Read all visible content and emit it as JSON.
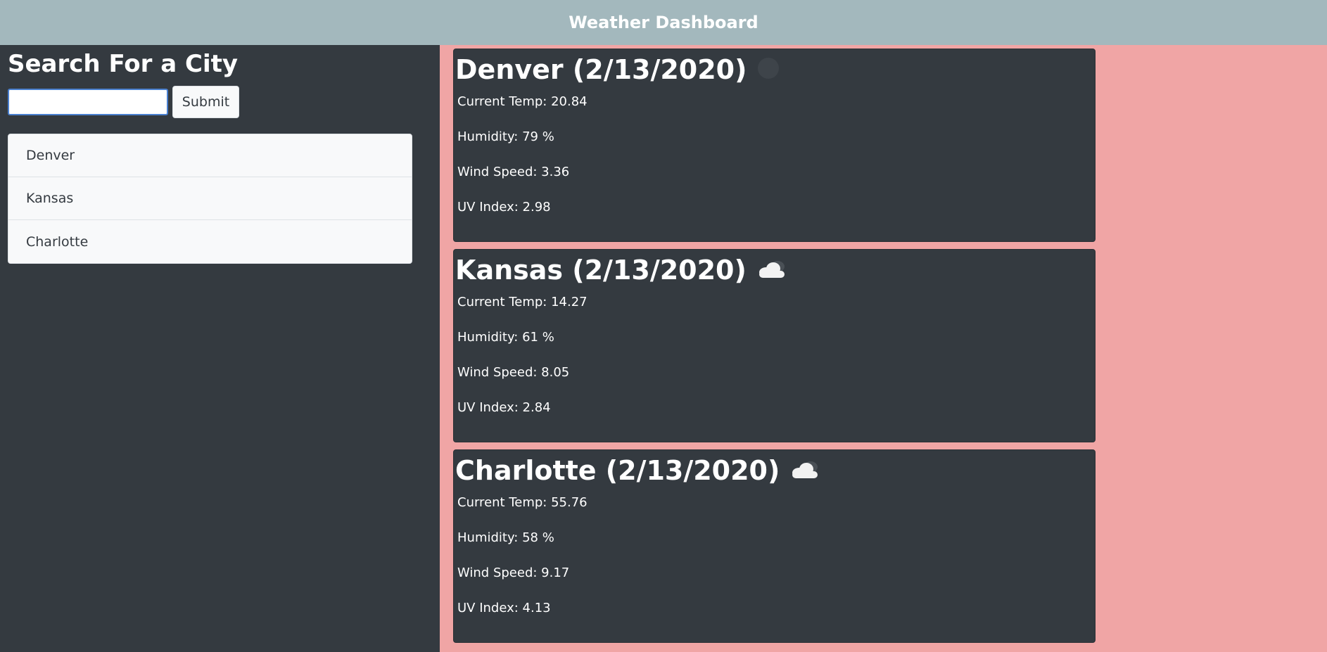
{
  "header": {
    "title": "Weather Dashboard"
  },
  "sidebar": {
    "heading": "Search For a City",
    "search": {
      "value": "",
      "placeholder": ""
    },
    "submit_label": "Submit",
    "cities": [
      "Denver",
      "Kansas",
      "Charlotte"
    ]
  },
  "cards": [
    {
      "city_date": "Denver (2/13/2020)",
      "icon": "moon-icon",
      "temp": "Current Temp: 20.84",
      "humidity": "Humidity: 79 %",
      "wind": "Wind Speed: 3.36",
      "uv": "UV Index: 2.98"
    },
    {
      "city_date": "Kansas (2/13/2020)",
      "icon": "cloud-icon",
      "temp": "Current Temp: 14.27",
      "humidity": "Humidity: 61 %",
      "wind": "Wind Speed: 8.05",
      "uv": "UV Index: 2.84"
    },
    {
      "city_date": "Charlotte (2/13/2020)",
      "icon": "cloud-icon",
      "temp": "Current Temp: 55.76",
      "humidity": "Humidity: 58 %",
      "wind": "Wind Speed: 9.17",
      "uv": "UV Index: 4.13"
    }
  ],
  "colors": {
    "header_bg": "#a3b8bd",
    "sidebar_bg": "#343a40",
    "content_bg": "#f0a5a5",
    "card_bg": "#343a40"
  }
}
